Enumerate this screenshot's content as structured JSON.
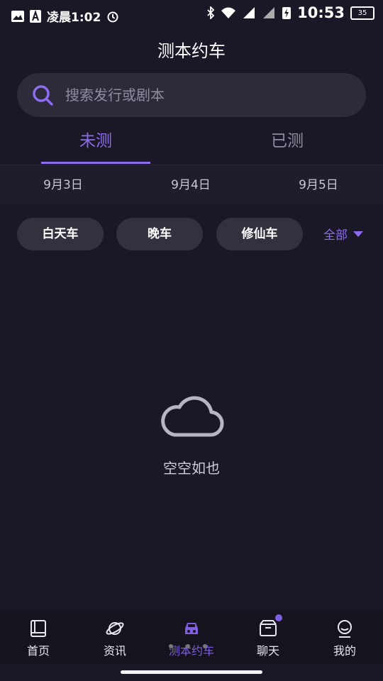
{
  "status_bar": {
    "left_text": "凌晨1:02",
    "time": "10:53",
    "battery": "35",
    "icons": [
      "image-icon",
      "a-icon",
      "alarm-icon",
      "bluetooth-icon",
      "wifi-icon",
      "signal-icon",
      "hd-signal-icon",
      "charging-icon",
      "battery-icon"
    ]
  },
  "header": {
    "title": "测本约车"
  },
  "search": {
    "placeholder": "搜索发行或剧本"
  },
  "tabs": [
    {
      "label": "未测",
      "active": true
    },
    {
      "label": "已测",
      "active": false
    }
  ],
  "dates": [
    "9月3日",
    "9月4日",
    "9月5日"
  ],
  "filters": {
    "chips": [
      "白天车",
      "晚车",
      "修仙车"
    ],
    "all_label": "全部"
  },
  "empty": {
    "text": "空空如也"
  },
  "bottom_nav": [
    {
      "label": "首页",
      "icon": "book-icon",
      "active": false
    },
    {
      "label": "资讯",
      "icon": "planet-icon",
      "active": false
    },
    {
      "label": "测本约车",
      "icon": "car-icon",
      "active": true
    },
    {
      "label": "聊天",
      "icon": "inbox-icon",
      "active": false,
      "badge": true
    },
    {
      "label": "我的",
      "icon": "profile-icon",
      "active": false
    }
  ],
  "colors": {
    "accent": "#8d6cf0",
    "background": "#1a1726",
    "chip": "#34313f",
    "search_bg": "#2d2a3a"
  }
}
